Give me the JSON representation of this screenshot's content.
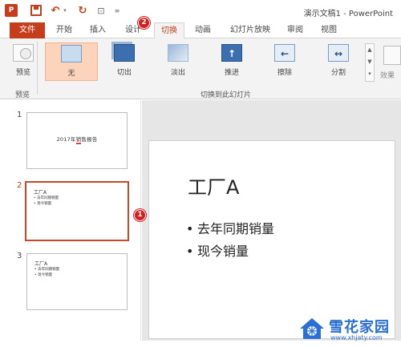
{
  "window": {
    "title": "演示文稿1 - PowerPoint"
  },
  "quick_access": {
    "app_logo": "P"
  },
  "tabs": [
    {
      "label": "文件",
      "key": "file"
    },
    {
      "label": "开始",
      "key": "home"
    },
    {
      "label": "插入",
      "key": "insert"
    },
    {
      "label": "设计",
      "key": "design"
    },
    {
      "label": "切换",
      "key": "transitions",
      "active": true
    },
    {
      "label": "动画",
      "key": "animations"
    },
    {
      "label": "幻灯片放映",
      "key": "slideshow"
    },
    {
      "label": "审阅",
      "key": "review"
    },
    {
      "label": "视图",
      "key": "view"
    }
  ],
  "ribbon": {
    "preview_label": "预览",
    "preview_group": "预览",
    "transitions": [
      {
        "label": "无",
        "icon": "none-transition-icon",
        "selected": true
      },
      {
        "label": "切出",
        "icon": "cut-transition-icon"
      },
      {
        "label": "淡出",
        "icon": "fade-transition-icon"
      },
      {
        "label": "推进",
        "icon": "push-transition-icon"
      },
      {
        "label": "擦除",
        "icon": "wipe-transition-icon"
      },
      {
        "label": "分割",
        "icon": "split-transition-icon"
      }
    ],
    "transitions_group": "切换到此幻灯片",
    "effect_label": "效果"
  },
  "slides": [
    {
      "number": "1",
      "title": "2017年销售报告"
    },
    {
      "number": "2",
      "title": "工厂A",
      "bullets": [
        "去年同期销量",
        "现今销量"
      ],
      "selected": true
    },
    {
      "number": "3",
      "title": "工厂A",
      "bullets": [
        "去年同期销量",
        "现今销量"
      ]
    }
  ],
  "current_slide": {
    "title": "工厂A",
    "bullets": [
      "去年同期销量",
      "现今销量"
    ]
  },
  "annotations": [
    "1",
    "2"
  ],
  "watermark": {
    "name": "雪花家园",
    "url": "www.xhjaty.com"
  },
  "colors": {
    "accent": "#c43e1c",
    "selection": "#fcd3bb",
    "badge": "#d21f1f",
    "watermark": "#2b6fd6"
  }
}
